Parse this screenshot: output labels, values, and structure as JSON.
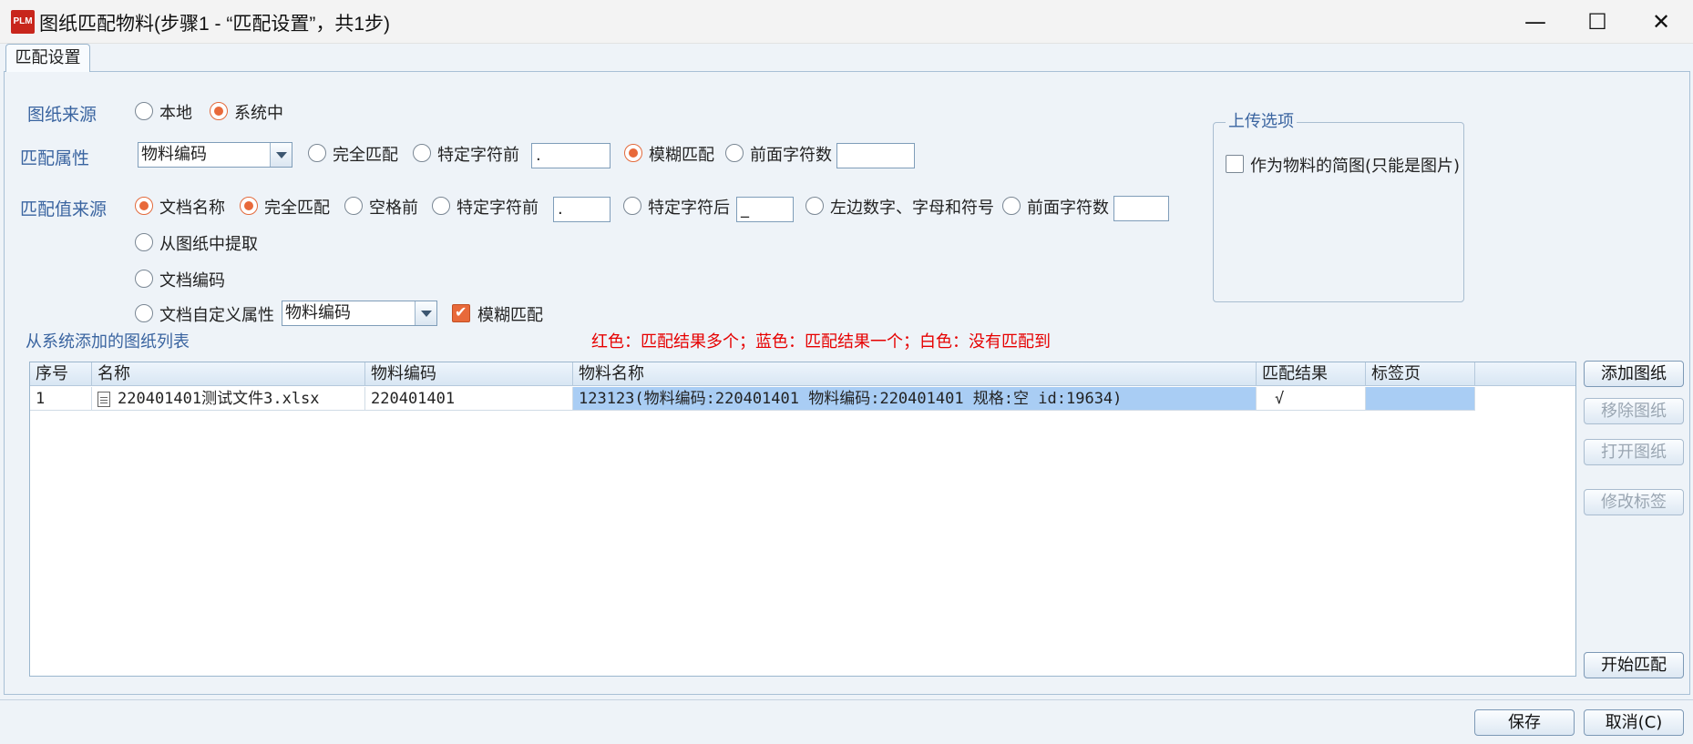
{
  "window": {
    "app_icon_text": "PLM",
    "title": "图纸匹配物料(步骤1 - “匹配设置”，共1步)",
    "minimize_glyph": "—",
    "maximize_glyph": "☐",
    "close_glyph": "✕"
  },
  "tab": {
    "label": "匹配设置"
  },
  "source": {
    "label": "图纸来源",
    "options": [
      {
        "label": "本地",
        "selected": false
      },
      {
        "label": "系统中",
        "selected": true
      }
    ]
  },
  "match_attr": {
    "label": "匹配属性",
    "combo_value": "物料编码",
    "options": [
      {
        "label": "完全匹配",
        "selected": false
      },
      {
        "label": "特定字符前",
        "selected": false
      },
      {
        "label": "模糊匹配",
        "selected": true
      },
      {
        "label": "前面字符数",
        "selected": false
      }
    ],
    "special_char_value": ".",
    "prefix_count_value": ""
  },
  "match_value_source": {
    "label": "匹配值来源",
    "options": [
      {
        "label": "文档名称",
        "selected": true
      },
      {
        "label": "从图纸中提取",
        "selected": false
      },
      {
        "label": "文档编码",
        "selected": false
      },
      {
        "label": "文档自定义属性",
        "selected": false
      }
    ],
    "sub_options": [
      {
        "label": "完全匹配",
        "selected": true
      },
      {
        "label": "空格前",
        "selected": false
      },
      {
        "label": "特定字符前",
        "selected": false
      },
      {
        "label": "特定字符后",
        "selected": false
      },
      {
        "label": "左边数字、字母和符号",
        "selected": false
      },
      {
        "label": "前面字符数",
        "selected": false
      }
    ],
    "before_char_value": ".",
    "after_char_value": "_",
    "prefix_count_value": "",
    "custom_attr_combo": "物料编码",
    "fuzzy_label": "模糊匹配",
    "fuzzy_checked": true
  },
  "upload": {
    "group_title": "上传选项",
    "thumbnail_label": "作为物料的简图(只能是图片)",
    "thumbnail_checked": false
  },
  "list": {
    "title": "从系统添加的图纸列表",
    "legend": "红色：匹配结果多个；蓝色：匹配结果一个；白色：没有匹配到",
    "headers": [
      "序号",
      "名称",
      "物料编码",
      "物料名称",
      "匹配结果",
      "标签页"
    ],
    "rows": [
      {
        "index": "1",
        "name": "220401401测试文件3.xlsx",
        "code": "220401401",
        "material_name": "123123(物料编码:220401401 物料编码:220401401 规格:空 id:19634)",
        "result": "√",
        "tab_page": ""
      }
    ]
  },
  "side_buttons": {
    "add": "添加图纸",
    "remove": "移除图纸",
    "open": "打开图纸",
    "edit_tag": "修改标签",
    "start": "开始匹配"
  },
  "footer": {
    "save": "保存",
    "cancel": "取消(C)"
  },
  "colors": {
    "accent_orange": "#e8693a",
    "label_blue": "#3a64a0",
    "legend_red": "#e60000",
    "highlight_blue": "#a9cdf4"
  }
}
